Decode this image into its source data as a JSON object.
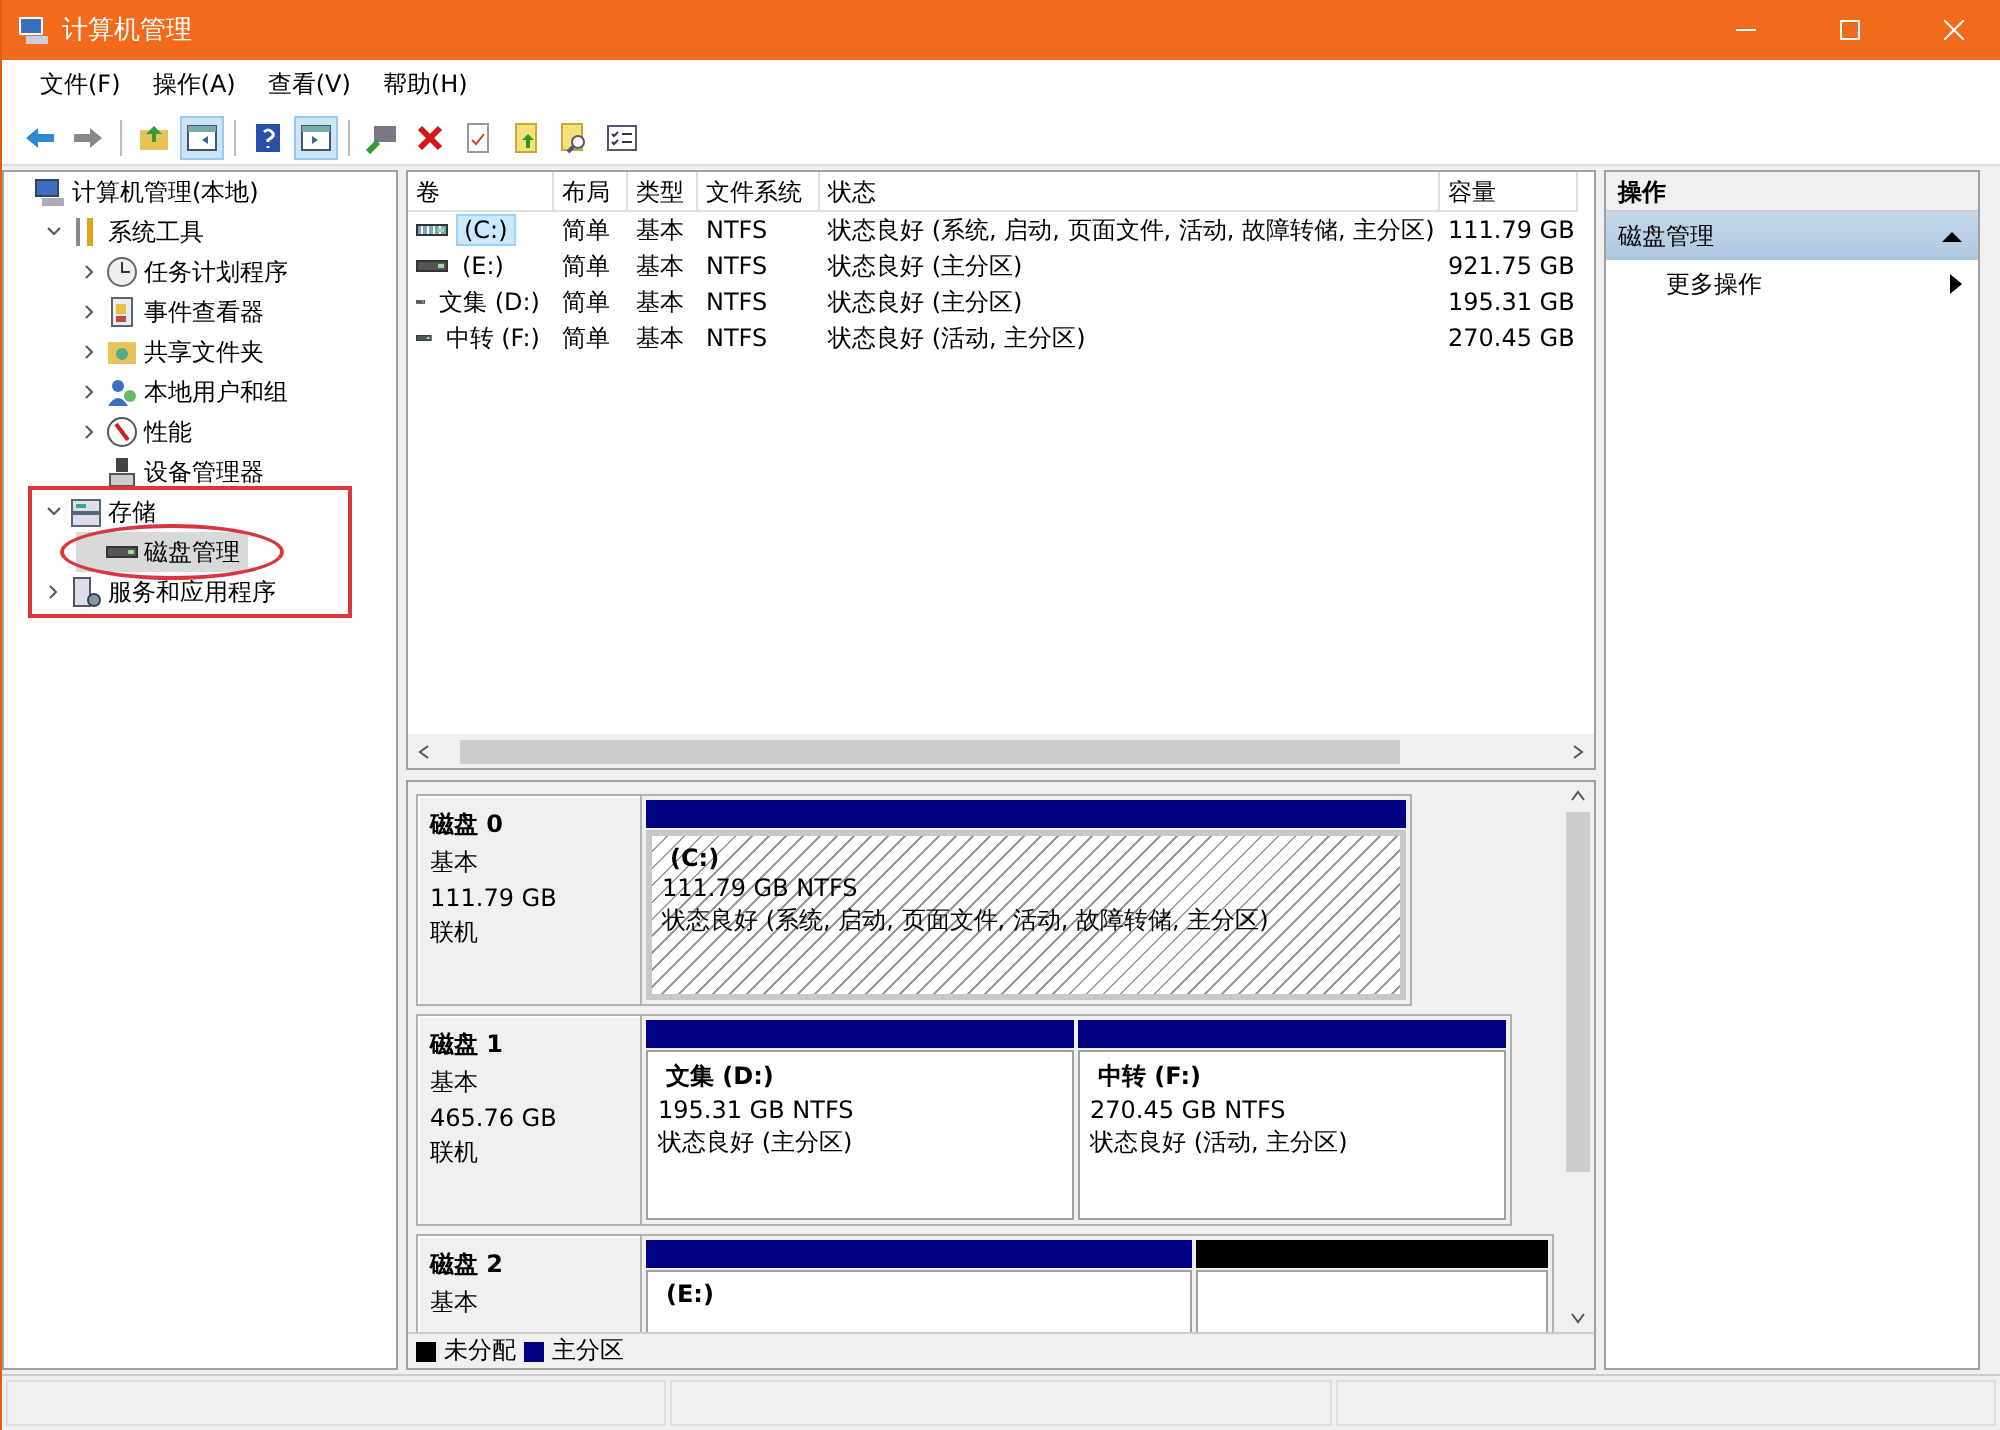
{
  "window": {
    "title": "计算机管理"
  },
  "menu": [
    "文件(F)",
    "操作(A)",
    "查看(V)",
    "帮助(H)"
  ],
  "toolbar": [
    {
      "kind": "back",
      "pressed": false
    },
    {
      "kind": "forward",
      "pressed": false
    },
    {
      "kind": "sep"
    },
    {
      "kind": "up",
      "pressed": false
    },
    {
      "kind": "tree",
      "pressed": true
    },
    {
      "kind": "sep"
    },
    {
      "kind": "help",
      "pressed": false
    },
    {
      "kind": "pane",
      "pressed": true
    },
    {
      "kind": "sep"
    },
    {
      "kind": "connect",
      "pressed": false
    },
    {
      "kind": "delete",
      "pressed": false
    },
    {
      "kind": "properties",
      "pressed": false
    },
    {
      "kind": "export",
      "pressed": false
    },
    {
      "kind": "find",
      "pressed": false
    },
    {
      "kind": "list",
      "pressed": false
    }
  ],
  "tree": [
    {
      "label": "计算机管理(本地)",
      "kind": "computer",
      "selected": false,
      "children": [
        {
          "label": "系统工具",
          "kind": "tools",
          "expanded": true,
          "selected": false,
          "children": [
            {
              "label": "任务计划程序",
              "kind": "clock",
              "expanded": false,
              "selected": false
            },
            {
              "label": "事件查看器",
              "kind": "event",
              "expanded": false,
              "selected": false
            },
            {
              "label": "共享文件夹",
              "kind": "share",
              "expanded": false,
              "selected": false
            },
            {
              "label": "本地用户和组",
              "kind": "users",
              "expanded": false,
              "selected": false
            },
            {
              "label": "性能",
              "kind": "perf",
              "expanded": false,
              "selected": false
            },
            {
              "label": "设备管理器",
              "kind": "device",
              "selected": false
            }
          ]
        },
        {
          "label": "存储",
          "kind": "storage",
          "expanded": true,
          "selected": false,
          "children": [
            {
              "label": "磁盘管理",
              "kind": "disk",
              "selected": true
            }
          ]
        },
        {
          "label": "服务和应用程序",
          "kind": "services",
          "expanded": false,
          "selected": false
        }
      ]
    }
  ],
  "table": {
    "columns": [
      "卷",
      "布局",
      "类型",
      "文件系统",
      "状态",
      "容量"
    ],
    "rows": [
      {
        "kind": "system",
        "selected": true,
        "cells": [
          "(C:)",
          "简单",
          "基本",
          "NTFS",
          "状态良好 (系统, 启动, 页面文件, 活动, 故障转储, 主分区)",
          "111.79 GB"
        ]
      },
      {
        "kind": "basic",
        "selected": false,
        "cells": [
          "(E:)",
          "简单",
          "基本",
          "NTFS",
          "状态良好 (主分区)",
          "921.75 GB"
        ]
      },
      {
        "kind": "basic",
        "selected": false,
        "cells": [
          "文集 (D:)",
          "简单",
          "基本",
          "NTFS",
          "状态良好 (主分区)",
          "195.31 GB"
        ]
      },
      {
        "kind": "basic",
        "selected": false,
        "cells": [
          "中转 (F:)",
          "简单",
          "基本",
          "NTFS",
          "状态良好 (活动, 主分区)",
          "270.45 GB"
        ]
      }
    ]
  },
  "disks": [
    {
      "name": "磁盘 0",
      "type": "基本",
      "size": "111.79 GB",
      "status": "联机",
      "partitions": [
        {
          "label": "(C:)",
          "detail": "111.79 GB NTFS",
          "status": "状态良好 (系统, 启动, 页面文件, 活动, 故障转储, 主分区)",
          "color": "#000080",
          "selected": true
        }
      ]
    },
    {
      "name": "磁盘 1",
      "type": "基本",
      "size": "465.76 GB",
      "status": "联机",
      "partitions": [
        {
          "label": "文集  (D:)",
          "detail": "195.31 GB NTFS",
          "status": "状态良好 (主分区)",
          "color": "#000080",
          "selected": false
        },
        {
          "label": "中转  (F:)",
          "detail": "270.45 GB NTFS",
          "status": "状态良好 (活动, 主分区)",
          "color": "#000080",
          "selected": false
        }
      ]
    },
    {
      "name": "磁盘 2",
      "type": "基本",
      "partitions": [
        {
          "label": "(E:)",
          "color": "#000080",
          "selected": false
        },
        {
          "color": "#000000",
          "selected": false
        }
      ]
    }
  ],
  "legend": [
    {
      "label": "未分配",
      "color": "#000000"
    },
    {
      "label": "主分区",
      "color": "#000080"
    }
  ],
  "actions": {
    "title": "操作",
    "section": {
      "label": "磁盘管理",
      "expanded": true
    },
    "items": [
      "更多操作"
    ]
  }
}
